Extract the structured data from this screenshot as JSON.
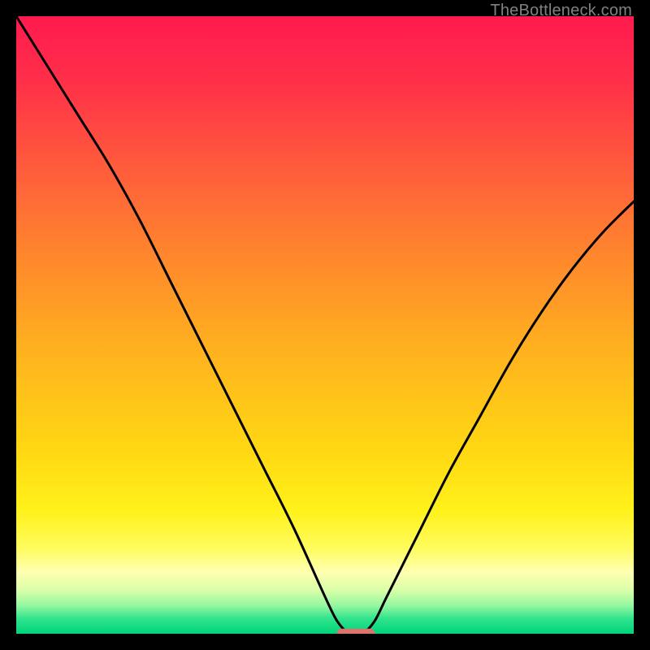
{
  "watermark": "TheBottleneck.com",
  "colors": {
    "frame": "#000000",
    "gradient_stops": [
      {
        "offset": 0.0,
        "color": "#ff1a4f"
      },
      {
        "offset": 0.1,
        "color": "#ff2e49"
      },
      {
        "offset": 0.25,
        "color": "#ff5d3b"
      },
      {
        "offset": 0.4,
        "color": "#ff8a2c"
      },
      {
        "offset": 0.55,
        "color": "#ffb41e"
      },
      {
        "offset": 0.7,
        "color": "#ffd713"
      },
      {
        "offset": 0.8,
        "color": "#fff11a"
      },
      {
        "offset": 0.86,
        "color": "#fffc5c"
      },
      {
        "offset": 0.9,
        "color": "#ffffb0"
      },
      {
        "offset": 0.93,
        "color": "#d8ffa8"
      },
      {
        "offset": 0.955,
        "color": "#93f7a0"
      },
      {
        "offset": 0.975,
        "color": "#32e38d"
      },
      {
        "offset": 1.0,
        "color": "#00d47a"
      }
    ],
    "curve": "#000000",
    "marker_fill": "#d9766b",
    "marker_stroke": "#d9766b"
  },
  "chart_data": {
    "type": "line",
    "title": "",
    "xlabel": "",
    "ylabel": "",
    "xlim": [
      0,
      100
    ],
    "ylim": [
      0,
      100
    ],
    "grid": false,
    "legend": false,
    "series": [
      {
        "name": "curve",
        "x": [
          0,
          5,
          10,
          15,
          20,
          25,
          30,
          35,
          40,
          45,
          50,
          52,
          54,
          56,
          58,
          60,
          65,
          70,
          75,
          80,
          85,
          90,
          95,
          100
        ],
        "y": [
          100,
          92,
          84,
          76,
          67,
          57,
          47,
          37,
          27,
          17,
          6,
          2,
          0,
          0,
          2,
          6,
          16,
          26,
          35,
          44,
          52,
          59,
          65,
          70
        ]
      }
    ],
    "annotations": [
      {
        "type": "marker",
        "shape": "rounded-rect",
        "x_center": 55,
        "y_center": 0,
        "width": 6,
        "height": 1.5
      }
    ]
  }
}
